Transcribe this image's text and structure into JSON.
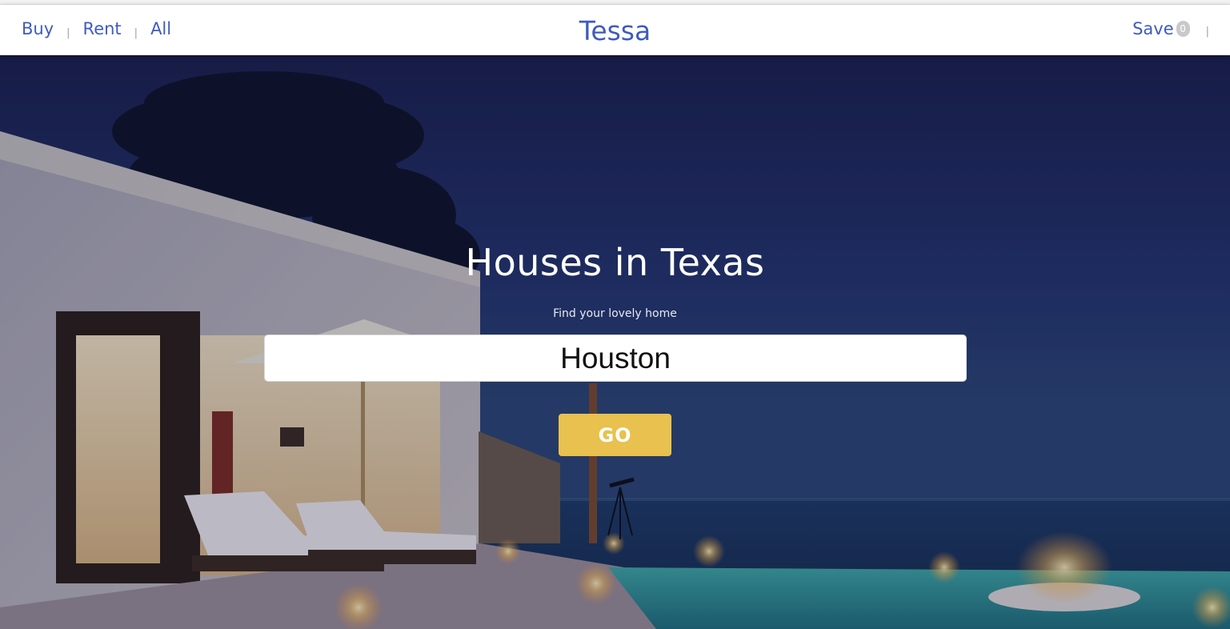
{
  "nav": {
    "links": [
      "Buy",
      "Rent",
      "All"
    ],
    "separator": "|",
    "brand": "Tessa",
    "save_label": "Save",
    "save_count": "0"
  },
  "hero": {
    "title": "Houses in Texas",
    "subtitle": "Find your lovely home",
    "search_value": "Houston",
    "go_label": "GO",
    "background_image": "night-villa-pool-ocean-photo"
  },
  "colors": {
    "link": "#3f5bbf",
    "go_button": "#e8c14e",
    "sky_dark": "#1a2352",
    "badge": "#c9c9c9"
  }
}
